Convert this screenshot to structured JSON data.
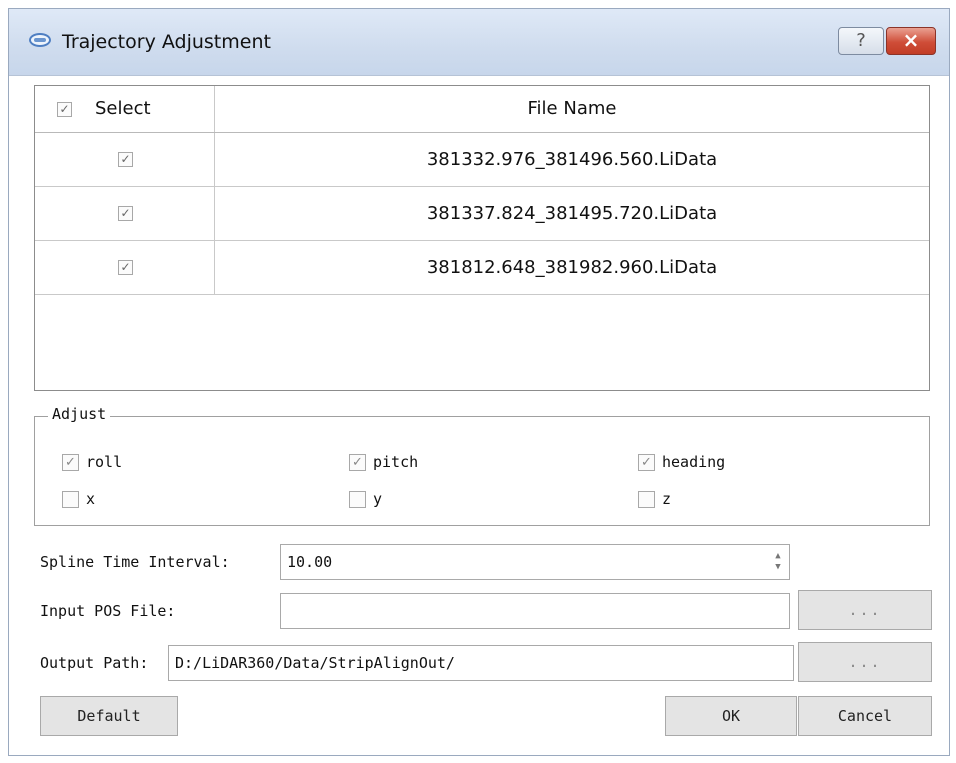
{
  "window": {
    "title": "Trajectory Adjustment",
    "help_glyph": "?",
    "close_glyph": "×"
  },
  "file_table": {
    "header": {
      "select_label": "Select",
      "file_name_label": "File Name",
      "select_checked": true
    },
    "rows": [
      {
        "checked": true,
        "file_name": "381332.976_381496.560.LiData"
      },
      {
        "checked": true,
        "file_name": "381337.824_381495.720.LiData"
      },
      {
        "checked": true,
        "file_name": "381812.648_381982.960.LiData"
      }
    ]
  },
  "adjust": {
    "legend": "Adjust",
    "options": [
      {
        "label": "roll",
        "checked": true
      },
      {
        "label": "pitch",
        "checked": true
      },
      {
        "label": "heading",
        "checked": true
      },
      {
        "label": "x",
        "checked": false
      },
      {
        "label": "y",
        "checked": false
      },
      {
        "label": "z",
        "checked": false
      }
    ]
  },
  "spline": {
    "label": "Spline Time Interval:",
    "value": "10.00"
  },
  "input_pos": {
    "label": "Input POS File:",
    "value": "",
    "browse_label": "..."
  },
  "output_path": {
    "label": "Output Path:",
    "value": "D:/LiDAR360/Data/StripAlignOut/",
    "browse_label": "..."
  },
  "buttons": {
    "default_label": "Default",
    "ok_label": "OK",
    "cancel_label": "Cancel"
  },
  "check_glyph": "✓",
  "colors": {
    "close_red": "#c94430",
    "titlebar": "#d3dff0"
  }
}
